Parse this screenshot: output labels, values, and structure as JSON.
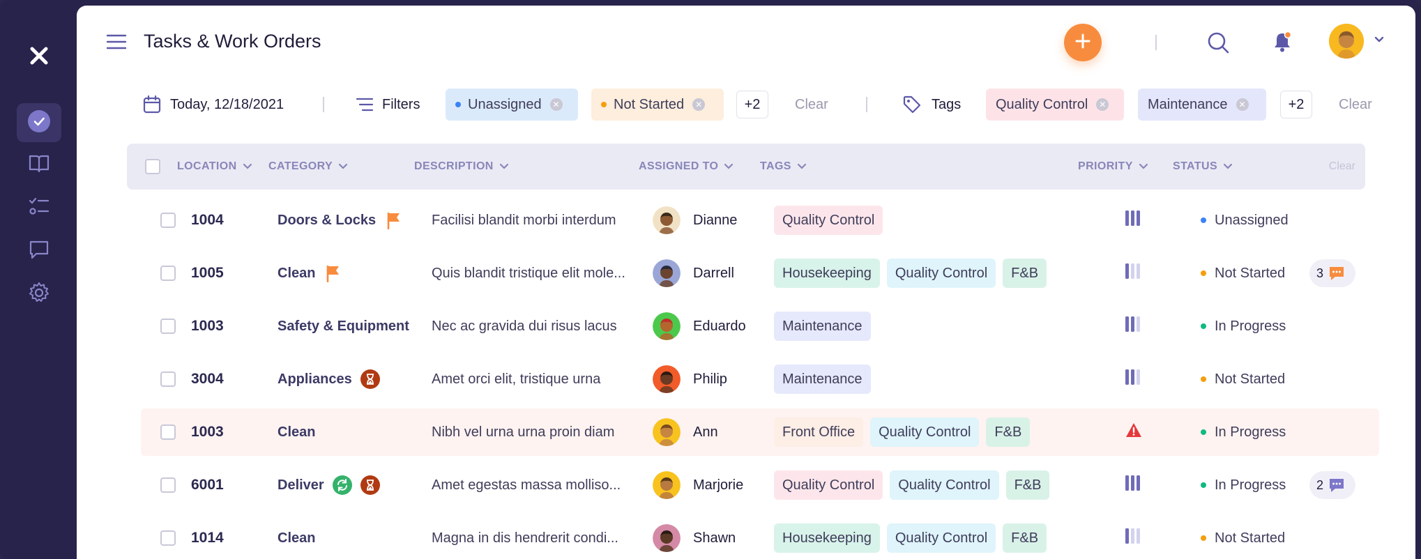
{
  "app": {
    "title": "Tasks & Work Orders"
  },
  "filterbar": {
    "date": "Today, 12/18/2021",
    "filters_label": "Filters",
    "filter_chips": [
      {
        "label": "Unassigned",
        "dot": "#3b82f6",
        "bg": "#dbeafb"
      },
      {
        "label": "Not Started",
        "dot": "#f59e0b",
        "bg": "#fdeedd"
      }
    ],
    "filters_more": "+2",
    "filters_clear": "Clear",
    "tags_label": "Tags",
    "tag_chips": [
      {
        "label": "Quality Control",
        "bg": "#fde3e8"
      },
      {
        "label": "Maintenance",
        "bg": "#e4e6fb"
      }
    ],
    "tags_more": "+2",
    "tags_clear": "Clear"
  },
  "table": {
    "headers": {
      "location": "LOCATION",
      "category": "CATEGORY",
      "description": "DESCRIPTION",
      "assigned_to": "ASSIGNED TO",
      "tags": "TAGS",
      "priority": "PRIORITY",
      "status": "STATUS",
      "clear": "Clear"
    },
    "rows": [
      {
        "location": "1004",
        "category": "Doors & Locks",
        "description": "Facilisi blandit morbi interdum",
        "assignee": "Dianne",
        "tags": [
          "Quality Control"
        ],
        "priority": 3,
        "status": "Unassigned",
        "status_color": "#3b82f6",
        "comments": null,
        "cat_icons": [
          "flag-icon"
        ]
      },
      {
        "location": "1005",
        "category": "Clean",
        "description": "Quis blandit tristique elit mole...",
        "assignee": "Darrell",
        "tags": [
          "Housekeeping",
          "Quality Control",
          "F&B"
        ],
        "priority": 1,
        "status": "Not Started",
        "status_color": "#f59e0b",
        "comments": "3",
        "cat_icons": [
          "flag-icon"
        ]
      },
      {
        "location": "1003",
        "category": "Safety & Equipment",
        "description": "Nec ac gravida dui risus lacus",
        "assignee": "Eduardo",
        "tags": [
          "Maintenance"
        ],
        "priority": 2,
        "status": "In Progress",
        "status_color": "#10b981",
        "comments": null,
        "cat_icons": []
      },
      {
        "location": "3004",
        "category": "Appliances",
        "description": "Amet orci elit, tristique urna",
        "assignee": "Philip",
        "tags": [
          "Maintenance"
        ],
        "priority": 2,
        "status": "Not Started",
        "status_color": "#f59e0b",
        "comments": null,
        "cat_icons": [
          "hourglass-icon"
        ]
      },
      {
        "location": "1003",
        "category": "Clean",
        "description": "Nibh vel urna urna proin diam",
        "assignee": "Ann",
        "tags": [
          "Front Office",
          "Quality Control",
          "F&B"
        ],
        "priority": "urgent",
        "status": "In Progress",
        "status_color": "#10b981",
        "comments": null,
        "cat_icons": []
      },
      {
        "location": "6001",
        "category": "Deliver",
        "description": "Amet egestas massa molliso...",
        "assignee": "Marjorie",
        "tags": [
          "Quality Control",
          "Quality Control",
          "F&B"
        ],
        "priority": 3,
        "status": "In Progress",
        "status_color": "#10b981",
        "comments": "2",
        "cat_icons": [
          "repeat-icon",
          "hourglass-icon"
        ]
      },
      {
        "location": "1014",
        "category": "Clean",
        "description": "Magna in dis hendrerit condi...",
        "assignee": "Shawn",
        "tags": [
          "Housekeeping",
          "Quality Control",
          "F&B"
        ],
        "priority": 1,
        "status": "Not Started",
        "status_color": "#f59e0b",
        "comments": null,
        "cat_icons": []
      }
    ]
  },
  "colors": {
    "sidebar_bg": "#27234b",
    "accent_orange": "#f88c3e",
    "priority_purple": "#6f6bb8",
    "urgent_red": "#e5383b"
  }
}
